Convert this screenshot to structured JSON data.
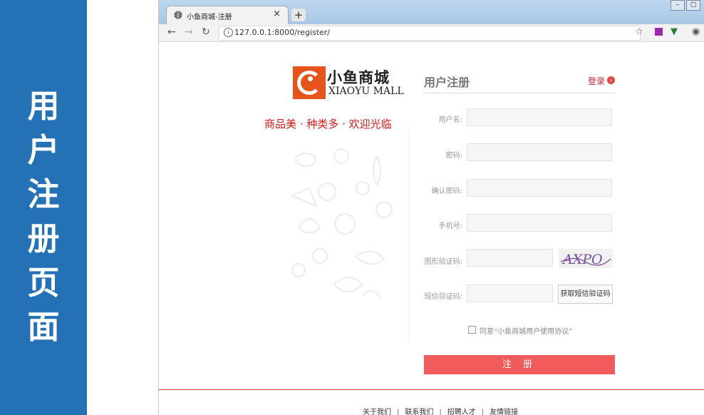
{
  "slide": {
    "title_chars": [
      "用",
      "户",
      "注",
      "册",
      "页",
      "面"
    ]
  },
  "browser": {
    "tab_title": "小鱼商城-注册",
    "tab_close": "×",
    "new_tab": "+",
    "url": "127.0.0.1:8000/register/",
    "window_controls": [
      "‒",
      "▢"
    ]
  },
  "page": {
    "brand_cn": "小鱼商城",
    "brand_en": "XIAOYU MALL",
    "slogan": "商品美 · 种类多 · 欢迎光临",
    "register_title": "用户注册",
    "login_link": "登录",
    "fields": {
      "username_label": "用户名:",
      "password_label": "密码:",
      "confirm_label": "确认密码:",
      "mobile_label": "手机号:",
      "image_code_label": "图形验证码:",
      "sms_code_label": "短信验证码:"
    },
    "captcha_text": "AXPO",
    "sms_button": "获取短信验证码",
    "agreement": "同意“小鱼商城用户使用协议”",
    "submit": "注 册",
    "footer_links": [
      "关于我们",
      "联系我们",
      "招聘人才",
      "友情链接"
    ]
  },
  "colors": {
    "slide_blue": "#2472b5",
    "brand_orange": "#e6541c",
    "accent_red": "#f25b5b",
    "slogan_red": "#d21a1a"
  }
}
